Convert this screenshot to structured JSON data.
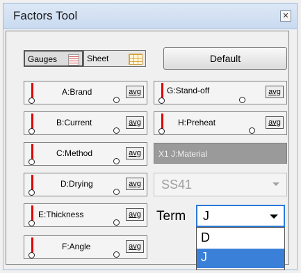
{
  "window": {
    "title": "Factors Tool",
    "close_glyph": "✕"
  },
  "toolbar": {
    "gauges_label": "Gauges",
    "sheet_label": "Sheet",
    "default_label": "Default"
  },
  "factors_left": [
    {
      "label": "A:Brand",
      "avg": "avg"
    },
    {
      "label": "B:Current",
      "avg": "avg"
    },
    {
      "label": "C:Method",
      "avg": "avg"
    },
    {
      "label": "D:Drying",
      "avg": "avg"
    },
    {
      "label": "E:Thickness",
      "avg": "avg"
    },
    {
      "label": "F:Angle",
      "avg": "avg"
    }
  ],
  "factors_right": [
    {
      "label": "G:Stand-off",
      "avg": "avg"
    },
    {
      "label": "H:Preheat",
      "avg": "avg"
    }
  ],
  "material": {
    "prefix": "X1",
    "label": "J:Material"
  },
  "material_value": {
    "value": "SS41"
  },
  "term": {
    "label": "Term",
    "value": "J",
    "options": [
      "D",
      "J"
    ],
    "selected": "J"
  },
  "colors": {
    "gauge_bar": "#e00000",
    "selection": "#3a80d8",
    "focus_border": "#2a7ad8"
  }
}
